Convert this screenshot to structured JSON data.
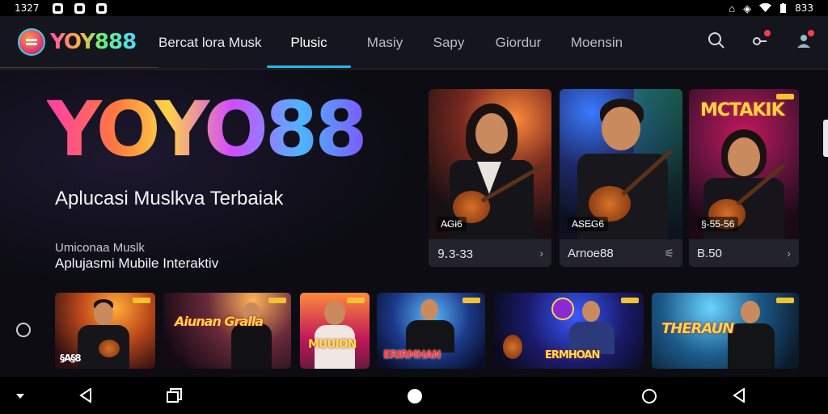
{
  "status_bar": {
    "time": "1327",
    "battery": "833",
    "left_icons": [
      "photo-icon",
      "check-icon",
      "shield-icon"
    ],
    "right_icons": [
      "home-icon",
      "vibrate-icon",
      "wifi-icon",
      "battery-icon"
    ]
  },
  "app": {
    "logo_text": "YOY888",
    "brand_colors": [
      "#ff4fb0",
      "#ffb347",
      "#6cf07a",
      "#4fd8ff"
    ]
  },
  "nav": {
    "items": [
      {
        "label": "Bercat lora Musk"
      },
      {
        "label": "Plusic"
      },
      {
        "label": "Masiy"
      },
      {
        "label": "Sapy"
      },
      {
        "label": "Giordur"
      },
      {
        "label": "Moensin"
      }
    ],
    "active_index": 1,
    "accent": "#29b6e6"
  },
  "hero": {
    "title": "YOYO88",
    "tagline": "Aplucasi Muslkva Terbaiak",
    "label": "Umiconaa Muslk",
    "subtitle": "Aplujasmi Mubile Interaktiv"
  },
  "featured": [
    {
      "caption": "⒐3-33",
      "tag": "A̶Gɨ6",
      "headline": ""
    },
    {
      "caption": "Arnoe88",
      "tag": "A̶SE̶G6",
      "headline": ""
    },
    {
      "caption": "B.50",
      "tag": "§-55-56",
      "headline": "MCTAKIK"
    }
  ],
  "thumbnails": [
    {
      "label": "§A§8"
    },
    {
      "label": "Aiunan Gralla"
    },
    {
      "label": "MUUION"
    },
    {
      "label": "ERIRMHAN"
    },
    {
      "label": "ERMHOAN"
    },
    {
      "label": "THERAUN"
    }
  ],
  "android_nav": [
    "collapse-icon",
    "back-icon",
    "recents-icon",
    "home-icon",
    "circle-icon",
    "back-triangle-icon"
  ]
}
